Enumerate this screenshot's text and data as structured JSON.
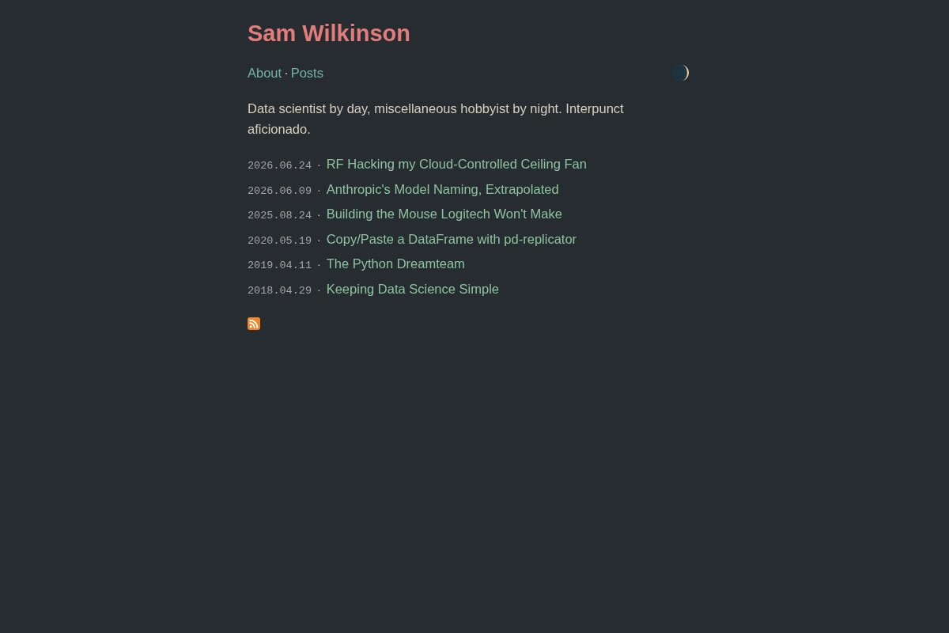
{
  "header": {
    "title": "Sam Wilkinson"
  },
  "nav": {
    "items": [
      {
        "kind": "link",
        "label": "About"
      },
      {
        "kind": "separator",
        "text": "·"
      },
      {
        "kind": "link",
        "label": "Posts"
      }
    ]
  },
  "intro": "Data scientist by day, miscellaneous hobbyist by night. Interpunct aficionado.",
  "posts": [
    {
      "date": "2026.06.24",
      "separator": "·",
      "title": "RF Hacking my Cloud-Controlled Ceiling Fan"
    },
    {
      "date": "2026.06.09",
      "separator": "·",
      "title": "Anthropic's Model Naming, Extrapolated"
    },
    {
      "date": "2025.08.24",
      "separator": "·",
      "title": "Building the Mouse Logitech Won't Make"
    },
    {
      "date": "2020.05.19",
      "separator": "·",
      "title": "Copy/Paste a DataFrame with pd-replicator"
    },
    {
      "date": "2019.04.11",
      "separator": "·",
      "title": "The Python Dreamteam"
    },
    {
      "date": "2018.04.29",
      "separator": "·",
      "title": "Keeping Data Science Simple"
    }
  ]
}
